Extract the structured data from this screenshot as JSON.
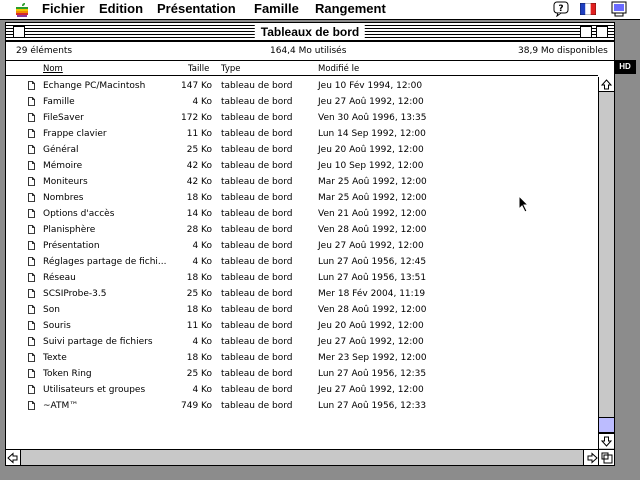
{
  "menubar": {
    "items": [
      "Fichier",
      "Edition",
      "Présentation",
      "Famille",
      "Rangement"
    ],
    "help_icon": "help-balloon-icon",
    "keyboard_icon": "french-flag-icon",
    "app_icon": "finder-app-icon"
  },
  "window": {
    "title": "Tableaux de bord",
    "info": {
      "items_count": "29 éléments",
      "used": "164,4 Mo utilisés",
      "available": "38,9 Mo disponibles"
    },
    "columns": {
      "name": "Nom",
      "size": "Taille",
      "type": "Type",
      "modified": "Modifié le"
    },
    "rows": [
      {
        "name": "Echange PC/Macintosh",
        "size": "147 Ko",
        "type": "tableau de bord",
        "date": "Jeu 10 Fév 1994, 12:00"
      },
      {
        "name": "Famille",
        "size": "4 Ko",
        "type": "tableau de bord",
        "date": "Jeu 27 Aoû 1992, 12:00"
      },
      {
        "name": "FileSaver",
        "size": "172 Ko",
        "type": "tableau de bord",
        "date": "Ven 30 Aoû 1996, 13:35"
      },
      {
        "name": "Frappe clavier",
        "size": "11 Ko",
        "type": "tableau de bord",
        "date": "Lun 14 Sep 1992, 12:00"
      },
      {
        "name": "Général",
        "size": "25 Ko",
        "type": "tableau de bord",
        "date": "Jeu 20 Aoû 1992, 12:00"
      },
      {
        "name": "Mémoire",
        "size": "42 Ko",
        "type": "tableau de bord",
        "date": "Jeu 10 Sep 1992, 12:00"
      },
      {
        "name": "Moniteurs",
        "size": "42 Ko",
        "type": "tableau de bord",
        "date": "Mar 25 Aoû 1992, 12:00"
      },
      {
        "name": "Nombres",
        "size": "18 Ko",
        "type": "tableau de bord",
        "date": "Mar 25 Aoû 1992, 12:00"
      },
      {
        "name": "Options d'accès",
        "size": "14 Ko",
        "type": "tableau de bord",
        "date": "Ven 21 Aoû 1992, 12:00"
      },
      {
        "name": "Planisphère",
        "size": "28 Ko",
        "type": "tableau de bord",
        "date": "Ven 28 Aoû 1992, 12:00"
      },
      {
        "name": "Présentation",
        "size": "4 Ko",
        "type": "tableau de bord",
        "date": "Jeu 27 Aoû 1992, 12:00"
      },
      {
        "name": "Réglages partage de fichi...",
        "size": "4 Ko",
        "type": "tableau de bord",
        "date": "Lun 27 Aoû 1956, 12:45"
      },
      {
        "name": "Réseau",
        "size": "18 Ko",
        "type": "tableau de bord",
        "date": "Lun 27 Aoû 1956, 13:51"
      },
      {
        "name": "SCSIProbe-3.5",
        "size": "25 Ko",
        "type": "tableau de bord",
        "date": "Mer 18 Fév 2004, 11:19"
      },
      {
        "name": "Son",
        "size": "18 Ko",
        "type": "tableau de bord",
        "date": "Ven 28 Aoû 1992, 12:00"
      },
      {
        "name": "Souris",
        "size": "11 Ko",
        "type": "tableau de bord",
        "date": "Jeu 20 Aoû 1992, 12:00"
      },
      {
        "name": "Suivi partage de fichiers",
        "size": "4 Ko",
        "type": "tableau de bord",
        "date": "Jeu 27 Aoû 1992, 12:00"
      },
      {
        "name": "Texte",
        "size": "18 Ko",
        "type": "tableau de bord",
        "date": "Mer 23 Sep 1992, 12:00"
      },
      {
        "name": "Token Ring",
        "size": "25 Ko",
        "type": "tableau de bord",
        "date": "Lun 27 Aoû 1956, 12:35"
      },
      {
        "name": "Utilisateurs et groupes",
        "size": "4 Ko",
        "type": "tableau de bord",
        "date": "Jeu 27 Aoû 1992, 12:00"
      },
      {
        "name": "~ATM™",
        "size": "749 Ko",
        "type": "tableau de bord",
        "date": "Lun 27 Aoû 1956, 12:33"
      }
    ]
  },
  "desktop": {
    "disk_label": "HD"
  }
}
